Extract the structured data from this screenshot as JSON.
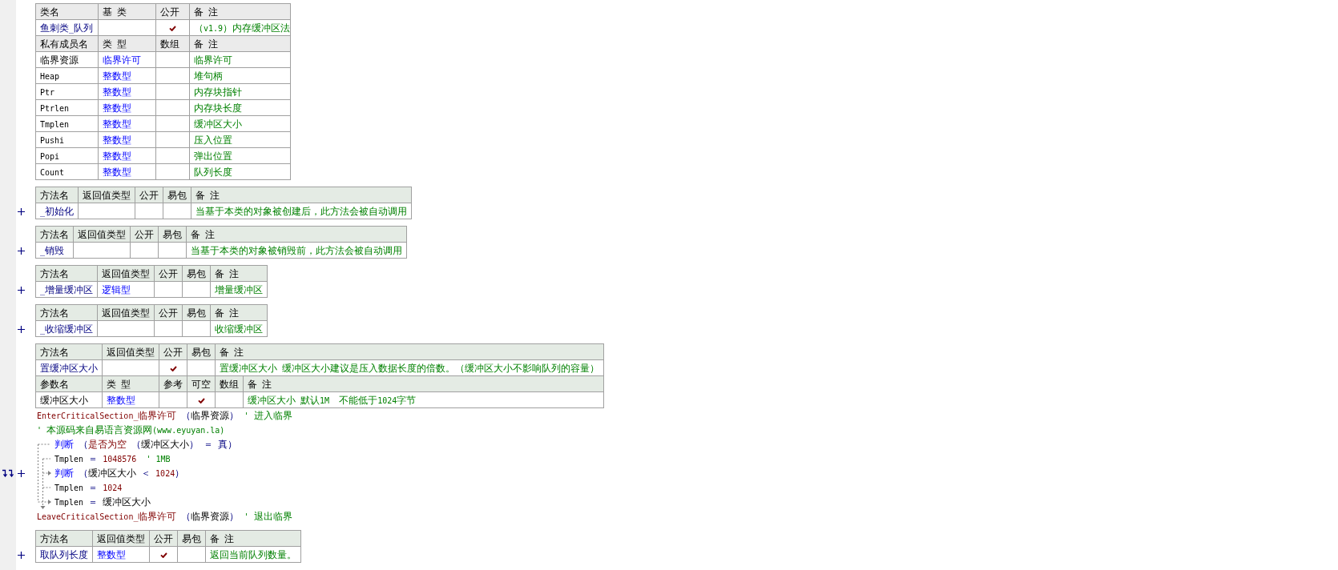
{
  "class_table": {
    "columns": [
      "类名",
      "基 类",
      "公开",
      "备 注"
    ],
    "class": {
      "name": "鱼刺类_队列",
      "public": true,
      "remark": "（v1.9）内存缓冲区法"
    },
    "member_columns": [
      "私有成员名",
      "类 型",
      "数组",
      "备 注"
    ],
    "members": [
      {
        "name": "临界资源",
        "type": "临界许可",
        "array": false,
        "remark": "临界许可"
      },
      {
        "name": "Heap",
        "type": "整数型",
        "array": false,
        "remark": "堆句柄"
      },
      {
        "name": "Ptr",
        "type": "整数型",
        "array": false,
        "remark": "内存块指针"
      },
      {
        "name": "Ptrlen",
        "type": "整数型",
        "array": false,
        "remark": "内存块长度"
      },
      {
        "name": "Tmplen",
        "type": "整数型",
        "array": false,
        "remark": "缓冲区大小"
      },
      {
        "name": "Pushi",
        "type": "整数型",
        "array": false,
        "remark": "压入位置"
      },
      {
        "name": "Popi",
        "type": "整数型",
        "array": false,
        "remark": "弹出位置"
      },
      {
        "name": "Count",
        "type": "整数型",
        "array": false,
        "remark": "队列长度"
      }
    ]
  },
  "methods": [
    {
      "columns": [
        "方法名",
        "返回值类型",
        "公开",
        "易包",
        "备 注"
      ],
      "name": "_初始化",
      "public": false,
      "easy_pack": false,
      "remark": "当基于本类的对象被创建后，此方法会被自动调用",
      "expanded": false
    },
    {
      "columns": [
        "方法名",
        "返回值类型",
        "公开",
        "易包",
        "备 注"
      ],
      "name": "_销毁",
      "public": false,
      "easy_pack": false,
      "remark": "当基于本类的对象被销毁前，此方法会被自动调用",
      "expanded": false
    },
    {
      "columns": [
        "方法名",
        "返回值类型",
        "公开",
        "易包",
        "备 注"
      ],
      "name": "_增量缓冲区",
      "return_type": "逻辑型",
      "public": false,
      "easy_pack": false,
      "remark": "增量缓冲区",
      "expanded": false
    },
    {
      "columns": [
        "方法名",
        "返回值类型",
        "公开",
        "易包",
        "备 注"
      ],
      "name": "_收缩缓冲区",
      "public": false,
      "easy_pack": false,
      "remark": "收缩缓冲区",
      "expanded": false
    },
    {
      "columns": [
        "方法名",
        "返回值类型",
        "公开",
        "易包",
        "备 注"
      ],
      "name": "置缓冲区大小",
      "public": true,
      "easy_pack": false,
      "remark": "置缓冲区大小 缓冲区大小建议是压入数据长度的倍数。（缓冲区大小不影响队列的容量）",
      "expanded": true,
      "params": {
        "columns": [
          "参数名",
          "类 型",
          "参考",
          "可空",
          "数组",
          "备 注"
        ],
        "rows": [
          {
            "name": "缓冲区大小",
            "type": "整数型",
            "reference": false,
            "nullable": true,
            "array": false,
            "remark": "缓冲区大小 默认1M  不能低于1024字节"
          }
        ]
      },
      "code": [
        {
          "kind": "line",
          "marker": false,
          "tokens": [
            {
              "kind": "func",
              "text": "EnterCriticalSection_临界许可"
            },
            {
              "kind": "op",
              "text": " （"
            },
            {
              "kind": "name",
              "text": "临界资源"
            },
            {
              "kind": "op",
              "text": "）"
            },
            {
              "kind": "comment",
              "text": " ' 进入临界"
            }
          ]
        },
        {
          "kind": "line",
          "marker": false,
          "tokens": [
            {
              "kind": "comment",
              "text": "' 本源码来自易语言资源网(www.eyuyan.la)"
            }
          ]
        },
        {
          "kind": "branch",
          "children": [
            {
              "kind": "line",
              "marker": false,
              "tokens": [
                {
                  "kind": "keyword",
                  "text": "判断"
                },
                {
                  "kind": "op",
                  "text": " （"
                },
                {
                  "kind": "func",
                  "text": "是否为空"
                },
                {
                  "kind": "op",
                  "text": " （"
                },
                {
                  "kind": "name",
                  "text": "缓冲区大小"
                },
                {
                  "kind": "op",
                  "text": "） ＝ "
                },
                {
                  "kind": "bool",
                  "text": "真"
                },
                {
                  "kind": "op",
                  "text": "）"
                }
              ]
            },
            {
              "kind": "line",
              "marker": false,
              "tokens": [
                {
                  "kind": "name",
                  "text": "Tmplen"
                },
                {
                  "kind": "op",
                  "text": " ＝ "
                },
                {
                  "kind": "const",
                  "text": "1048576"
                },
                {
                  "kind": "comment",
                  "text": "  ' 1MB"
                }
              ]
            },
            {
              "kind": "line",
              "marker": true,
              "tokens": [
                {
                  "kind": "keyword",
                  "text": "判断"
                },
                {
                  "kind": "op",
                  "text": " （"
                },
                {
                  "kind": "name",
                  "text": "缓冲区大小"
                },
                {
                  "kind": "op",
                  "text": " ＜ "
                },
                {
                  "kind": "const",
                  "text": "1024"
                },
                {
                  "kind": "op",
                  "text": "）"
                }
              ]
            },
            {
              "kind": "line",
              "marker": false,
              "tokens": [
                {
                  "kind": "name",
                  "text": "Tmplen"
                },
                {
                  "kind": "op",
                  "text": " ＝ "
                },
                {
                  "kind": "const",
                  "text": "1024"
                }
              ]
            },
            {
              "kind": "line",
              "marker": false,
              "tokens": [
                {
                  "kind": "name",
                  "text": "Tmplen"
                },
                {
                  "kind": "op",
                  "text": " ＝ "
                },
                {
                  "kind": "name",
                  "text": "缓冲区大小"
                }
              ]
            }
          ]
        },
        {
          "kind": "line",
          "marker": false,
          "tokens": [
            {
              "kind": "func",
              "text": "LeaveCriticalSection_临界许可"
            },
            {
              "kind": "op",
              "text": " （"
            },
            {
              "kind": "name",
              "text": "临界资源"
            },
            {
              "kind": "op",
              "text": "）"
            },
            {
              "kind": "comment",
              "text": " ' 退出临界"
            }
          ]
        }
      ]
    },
    {
      "columns": [
        "方法名",
        "返回值类型",
        "公开",
        "易包",
        "备 注"
      ],
      "name": "取队列长度",
      "return_type": "整数型",
      "public": true,
      "easy_pack": false,
      "remark": "返回当前队列数量。",
      "expanded": false
    }
  ]
}
